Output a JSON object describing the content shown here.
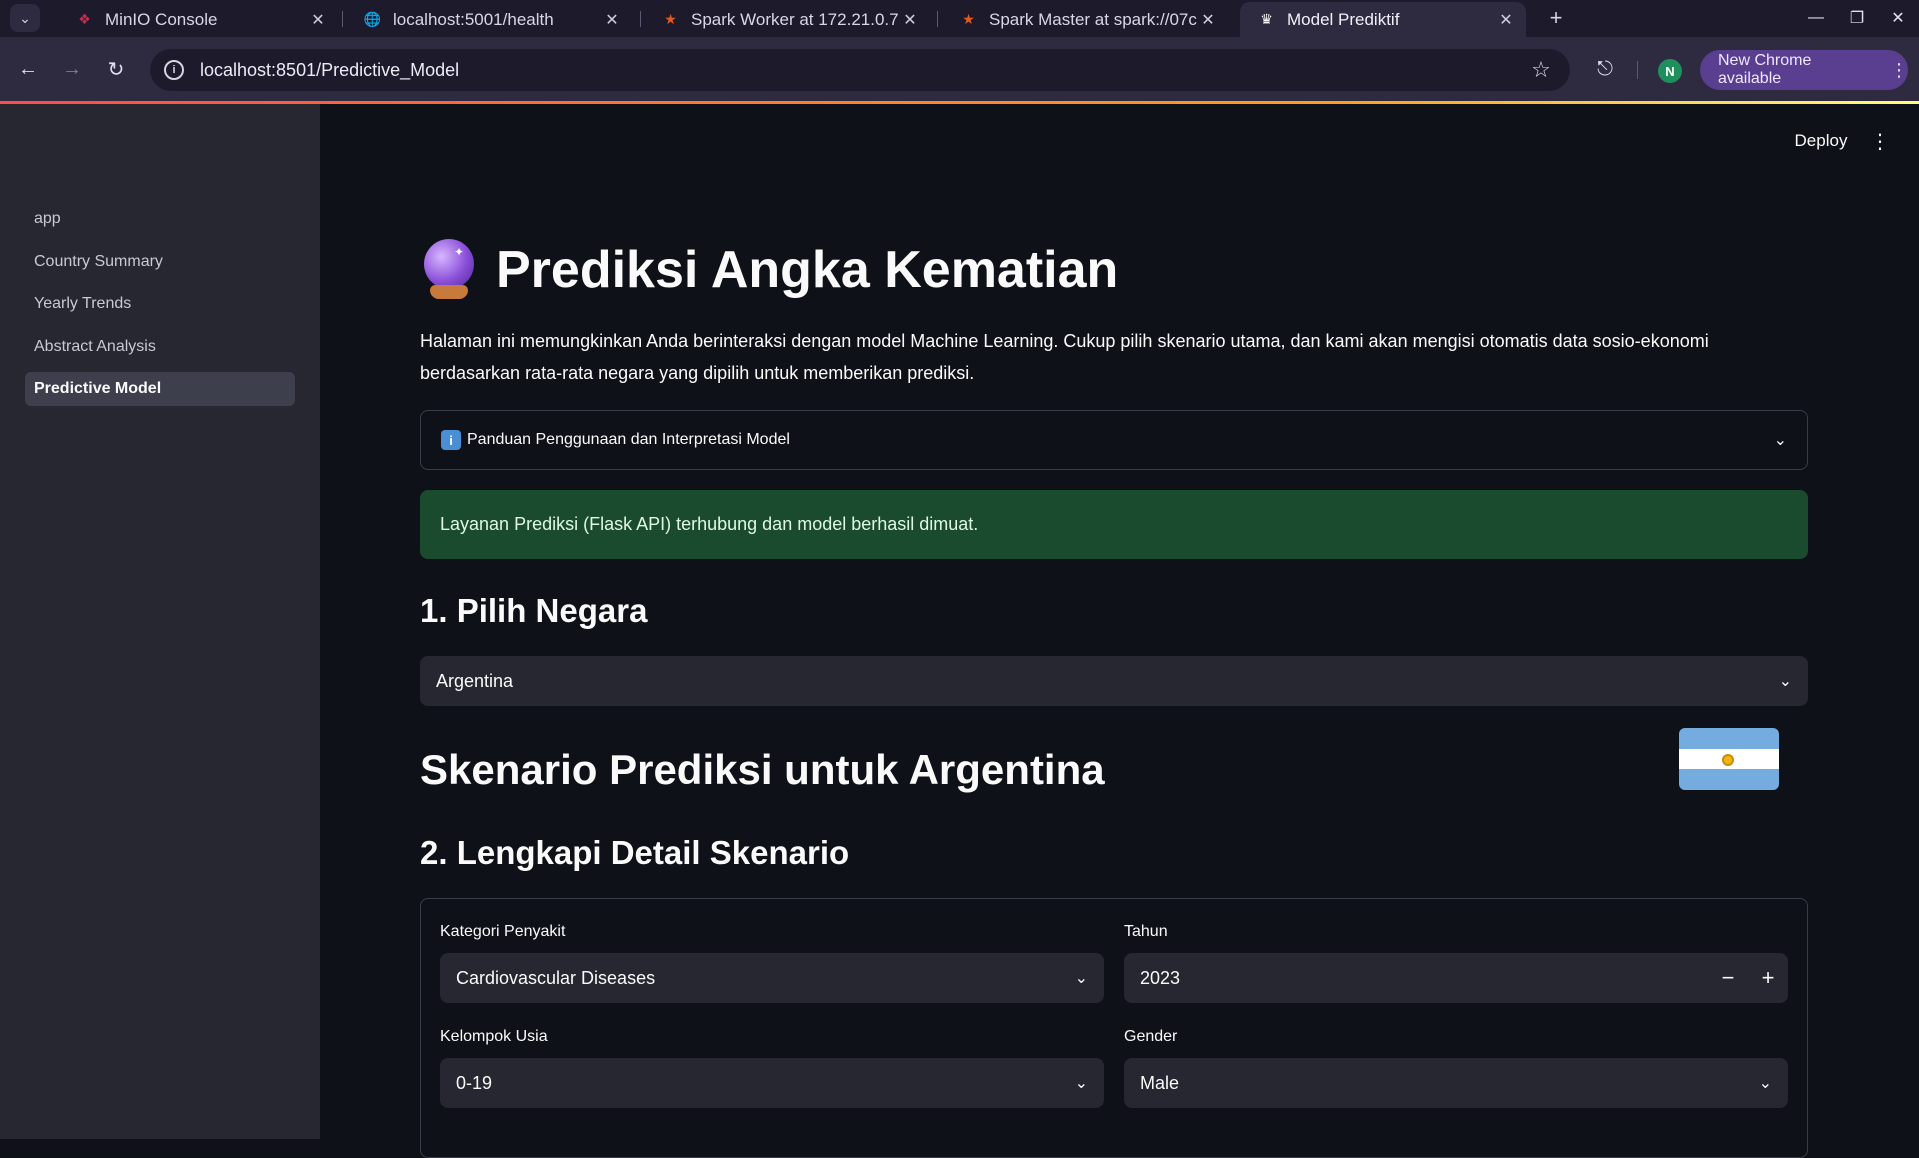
{
  "browser": {
    "tabs": [
      {
        "title": "MinIO Console",
        "favicon": "minio-flame-icon"
      },
      {
        "title": "localhost:5001/health",
        "favicon": "globe-icon"
      },
      {
        "title": "Spark Worker at 172.21.0.7:",
        "favicon": "spark-icon"
      },
      {
        "title": "Spark Master at spark://07c",
        "favicon": "spark-icon"
      },
      {
        "title": "Model Prediktif",
        "favicon": "streamlit-crown-icon"
      }
    ],
    "url": "localhost:8501/Predictive_Model",
    "profile_initial": "N",
    "update_label": "New Chrome available"
  },
  "sidebar": {
    "items": [
      {
        "label": "app",
        "active": false
      },
      {
        "label": "Country Summary",
        "active": false
      },
      {
        "label": "Yearly Trends",
        "active": false
      },
      {
        "label": "Abstract Analysis",
        "active": false
      },
      {
        "label": "Predictive Model",
        "active": true
      }
    ]
  },
  "header": {
    "deploy_label": "Deploy"
  },
  "main": {
    "title": "Prediksi Angka Kematian",
    "title_icon": "crystal-ball-icon",
    "intro": "Halaman ini memungkinkan Anda berinteraksi dengan model Machine Learning. Cukup pilih skenario utama, dan kami akan mengisi otomatis data sosio-ekonomi berdasarkan rata-rata negara yang dipilih untuk memberikan prediksi.",
    "expander_label": "Panduan Penggunaan dan Interpretasi Model",
    "success_message": "Layanan Prediksi (Flask API) terhubung dan model berhasil dimuat.",
    "section1_heading": "1. Pilih Negara",
    "country_value": "Argentina",
    "scenario_heading": "Skenario Prediksi untuk Argentina",
    "section2_heading": "2. Lengkapi Detail Skenario",
    "form": {
      "disease_label": "Kategori Penyakit",
      "disease_value": "Cardiovascular Diseases",
      "year_label": "Tahun",
      "year_value": "2023",
      "age_label": "Kelompok Usia",
      "age_value": "0-19",
      "gender_label": "Gender",
      "gender_value": "Male"
    }
  },
  "colors": {
    "background": "#0e1117",
    "sidebar": "#262730",
    "success_bg": "#1b4b2e",
    "accent": "#ff4b4b"
  }
}
